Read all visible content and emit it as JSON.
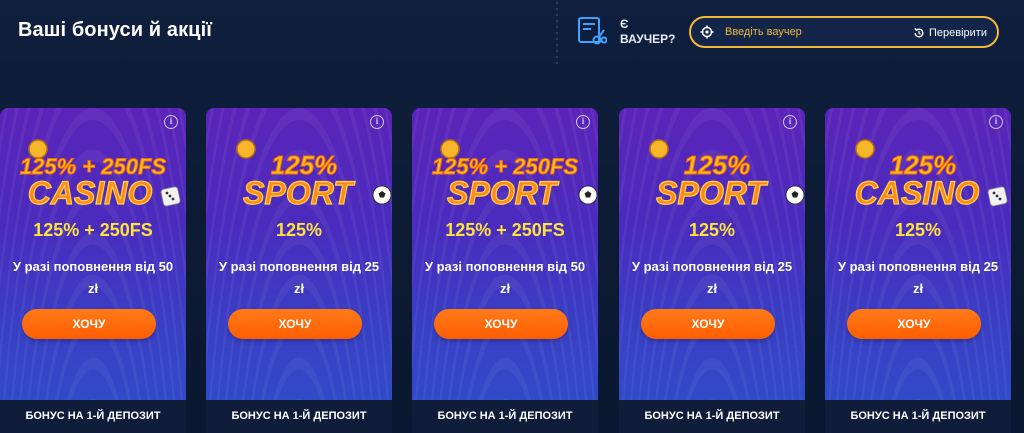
{
  "header": {
    "title": "Ваші бонуси й акції",
    "voucher_line1": "Є",
    "voucher_line2": "ВАУЧЕР?",
    "voucher_placeholder": "Введіть ваучер",
    "check_label": "Перевірити"
  },
  "colors": {
    "accent_yellow": "#ffe23d",
    "button_orange": "#ff6a00",
    "voucher_border": "#f2b93b",
    "card_top": "#5b24b8",
    "card_bottom": "#2d4fc9",
    "footer_bg": "#0f1d3a"
  },
  "cards": [
    {
      "art_line1": "125% + 250FS",
      "art_line2": "CASINO",
      "art_icon": "dice-icon",
      "value": "125% + 250FS",
      "condition": "У разі поповнення від 50 zł",
      "button_label": "ХОЧУ",
      "footer": "БОНУС НА 1-Й ДЕПОЗИТ"
    },
    {
      "art_line1": "125%",
      "art_line2": "SPORT",
      "art_icon": "soccer-ball-icon",
      "value": "125%",
      "condition": "У разі поповнення від 25 zł",
      "button_label": "ХОЧУ",
      "footer": "БОНУС НА 1-Й ДЕПОЗИТ"
    },
    {
      "art_line1": "125% + 250FS",
      "art_line2": "SPORT",
      "art_icon": "soccer-ball-icon",
      "value": "125% + 250FS",
      "condition": "У разі поповнення від 50 zł",
      "button_label": "ХОЧУ",
      "footer": "БОНУС НА 1-Й ДЕПОЗИТ"
    },
    {
      "art_line1": "125%",
      "art_line2": "SPORT",
      "art_icon": "soccer-ball-icon",
      "value": "125%",
      "condition": "У разі поповнення від 25 zł",
      "button_label": "ХОЧУ",
      "footer": "БОНУС НА 1-Й ДЕПОЗИТ"
    },
    {
      "art_line1": "125%",
      "art_line2": "CASINO",
      "art_icon": "dice-icon",
      "value": "125%",
      "condition": "У разі поповнення від 25 zł",
      "button_label": "ХОЧУ",
      "footer": "БОНУС НА 1-Й ДЕПОЗИТ"
    }
  ]
}
